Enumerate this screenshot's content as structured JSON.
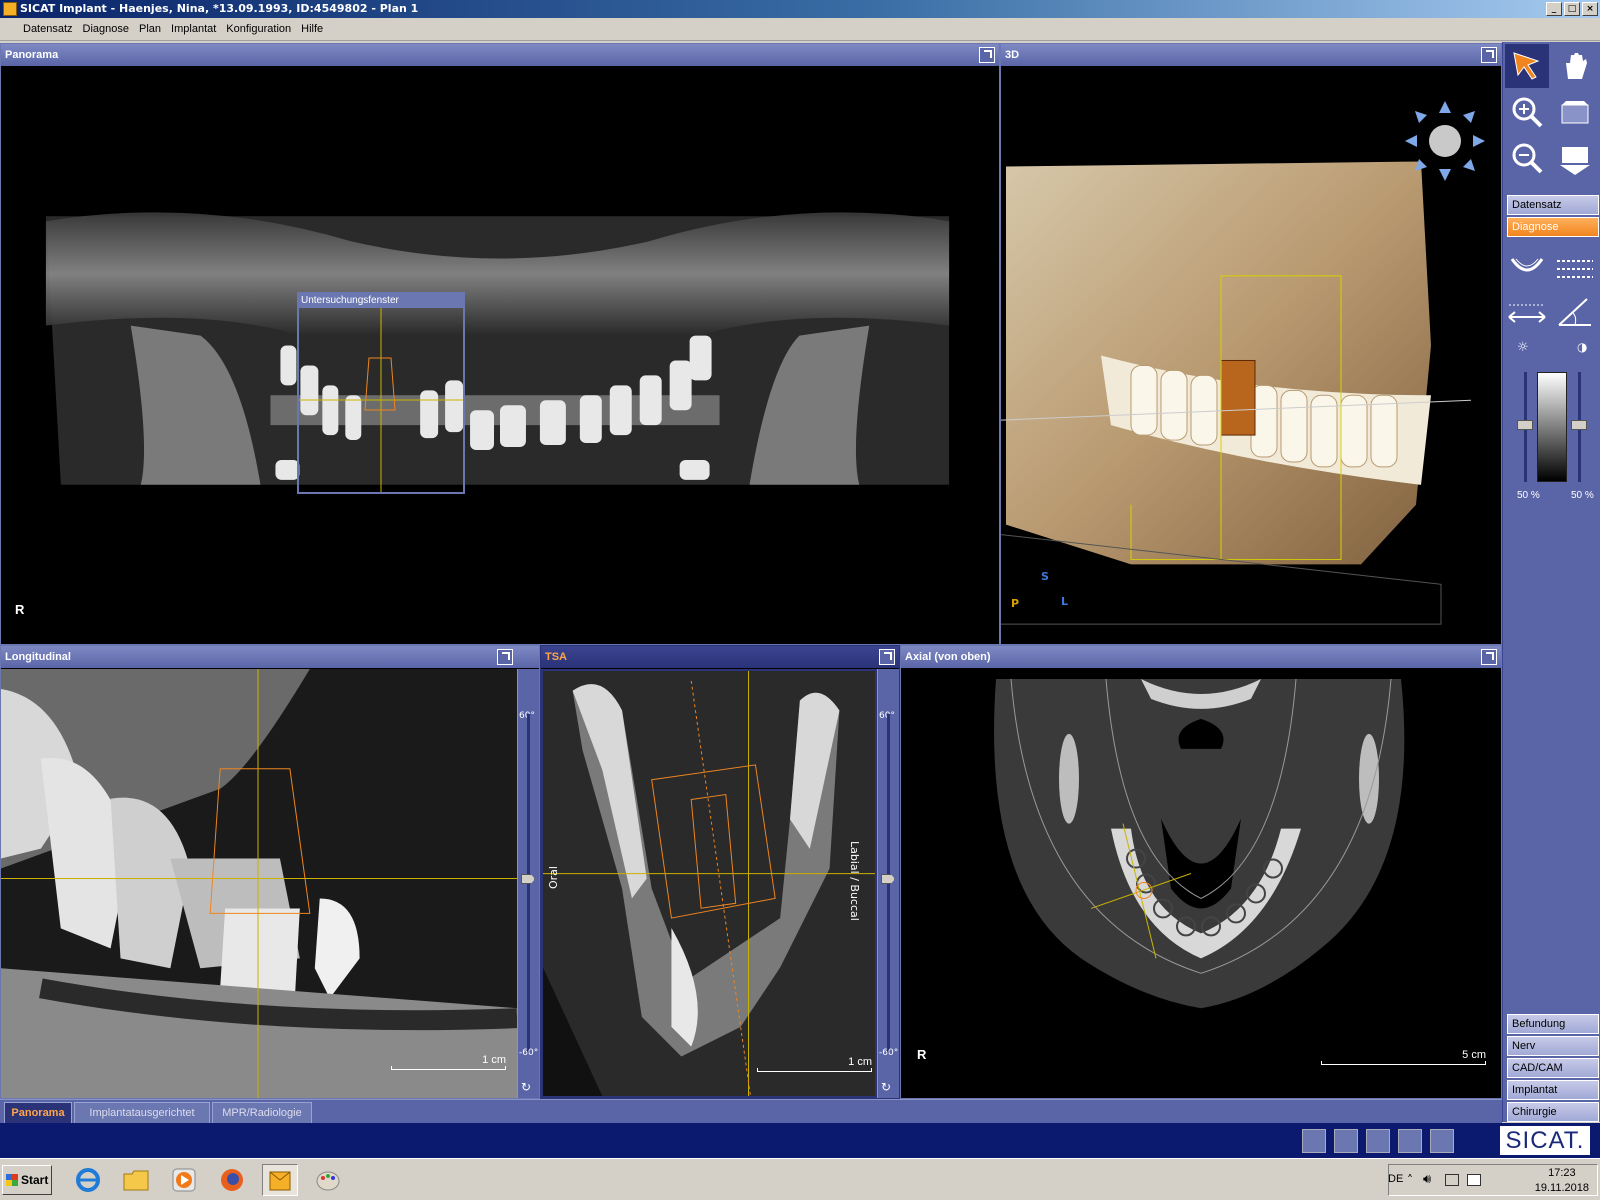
{
  "window": {
    "title": "SICAT Implant - Haenjes, Nina, *13.09.1993, ID:4549802 - Plan 1"
  },
  "menu": [
    "Datensatz",
    "Diagnose",
    "Plan",
    "Implantat",
    "Konfiguration",
    "Hilfe"
  ],
  "views": {
    "panorama": {
      "title": "Panorama",
      "orientation": "R",
      "popup_title": "Untersuchungsfenster"
    },
    "three_d": {
      "title": "3D",
      "axis_s": "S",
      "axis_p": "P",
      "axis_l": "L"
    },
    "longitudinal": {
      "title": "Longitudinal",
      "scale": "1 cm",
      "angle_top": "60°",
      "angle_bottom": "-60°"
    },
    "tsa": {
      "title": "TSA",
      "scale": "1 cm",
      "angle_top": "60°",
      "angle_bottom": "-60°",
      "label_left": "Oral",
      "label_right": "Labial / Buccal"
    },
    "axial": {
      "title": "Axial (von oben)",
      "orientation": "R",
      "scale": "5 cm"
    }
  },
  "sidebar": {
    "tools": [
      "select-arrow-icon",
      "pan-hand-icon",
      "zoom-in-icon",
      "slice-up-icon",
      "zoom-out-icon",
      "slice-down-icon"
    ],
    "top_tabs": [
      {
        "label": "Datensatz",
        "active": false
      },
      {
        "label": "Diagnose",
        "active": true
      }
    ],
    "brightness": "50 %",
    "contrast": "50 %",
    "bottom_tabs": [
      "Befundung",
      "Nerv",
      "CAD/CAM",
      "Implantat",
      "Chirurgie"
    ]
  },
  "workspace_tabs": [
    {
      "label": "Panorama",
      "active": true
    },
    {
      "label": "Implantatausgerichtet",
      "active": false
    },
    {
      "label": "MPR/Radiologie",
      "active": false
    }
  ],
  "brand": "SICAT.",
  "taskbar": {
    "start": "Start",
    "language": "DE",
    "time": "17:23",
    "date": "19.11.2018"
  },
  "colors": {
    "accent": "#f0851f",
    "panel": "#5a65a8",
    "crosshair": "#c8b400"
  }
}
